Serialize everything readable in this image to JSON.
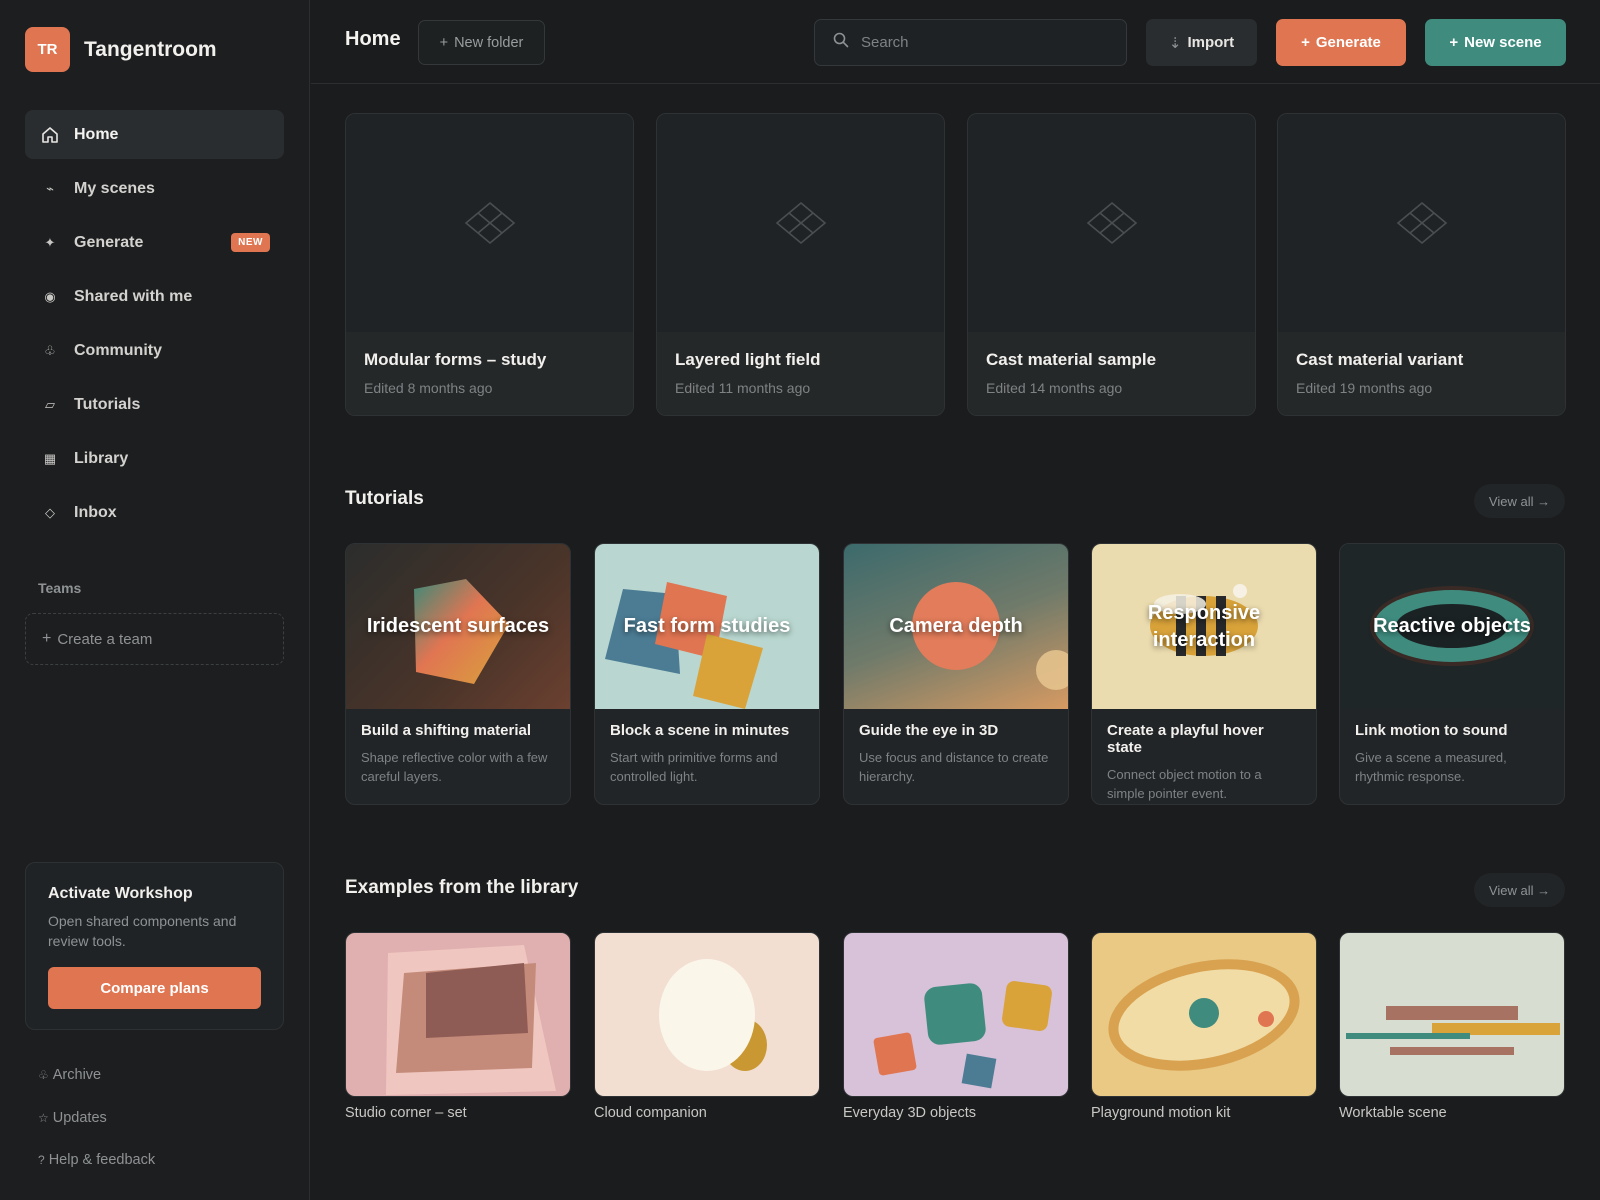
{
  "brand": {
    "initials": "TR",
    "name": "Tangentroom"
  },
  "sidebar": {
    "items": [
      {
        "label": "Home",
        "icon": "home-icon",
        "active": true
      },
      {
        "label": "My scenes",
        "icon": "scenes-icon"
      },
      {
        "label": "Generate",
        "icon": "sparkle-icon",
        "badge": "NEW"
      },
      {
        "label": "Shared with me",
        "icon": "shared-icon"
      },
      {
        "label": "Community",
        "icon": "community-icon"
      },
      {
        "label": "Tutorials",
        "icon": "tutorials-icon"
      },
      {
        "label": "Library",
        "icon": "library-icon"
      },
      {
        "label": "Inbox",
        "icon": "inbox-icon"
      }
    ],
    "teams_title": "Teams",
    "create_team": "Create a team",
    "workshop": {
      "title": "Activate Workshop",
      "description": "Open shared components and review tools.",
      "button": "Compare plans"
    },
    "footer": [
      {
        "label": "Archive",
        "icon": "archive-icon"
      },
      {
        "label": "Updates",
        "icon": "star-icon"
      },
      {
        "label": "Help & feedback",
        "icon": "help-icon"
      }
    ]
  },
  "header": {
    "title": "Home",
    "new_folder": "New folder",
    "search_placeholder": "Search",
    "import": "Import",
    "generate": "Generate",
    "new_scene": "New scene"
  },
  "recent_scenes": [
    {
      "title": "Modular forms – study",
      "edited": "Edited 8 months ago"
    },
    {
      "title": "Layered light field",
      "edited": "Edited 11 months ago"
    },
    {
      "title": "Cast material sample",
      "edited": "Edited 14 months ago"
    },
    {
      "title": "Cast material variant",
      "edited": "Edited 19 months ago"
    }
  ],
  "tutorials": {
    "title": "Tutorials",
    "view_all": "View all →",
    "items": [
      {
        "overlay": "Iridescent surfaces",
        "title": "Build a shifting material",
        "desc": "Shape reflective color with a few careful layers."
      },
      {
        "overlay": "Fast form studies",
        "title": "Block a scene in minutes",
        "desc": "Start with primitive forms and controlled light."
      },
      {
        "overlay": "Camera depth",
        "title": "Guide the eye in 3D",
        "desc": "Use focus and distance to create hierarchy."
      },
      {
        "overlay": "Responsive interaction",
        "title": "Create a playful hover state",
        "desc": "Connect object motion to a simple pointer event."
      },
      {
        "overlay": "Reactive objects",
        "title": "Link motion to sound",
        "desc": "Give a scene a measured, rhythmic response."
      }
    ]
  },
  "examples": {
    "title": "Examples from the library",
    "view_all": "View all →",
    "items": [
      {
        "label": "Studio corner – set"
      },
      {
        "label": "Cloud companion"
      },
      {
        "label": "Everyday 3D objects"
      },
      {
        "label": "Playground motion kit"
      },
      {
        "label": "Worktable scene"
      }
    ]
  },
  "colors": {
    "accent": "#e07552",
    "teal": "#3f8c7f",
    "background": "#1a1c1d"
  }
}
